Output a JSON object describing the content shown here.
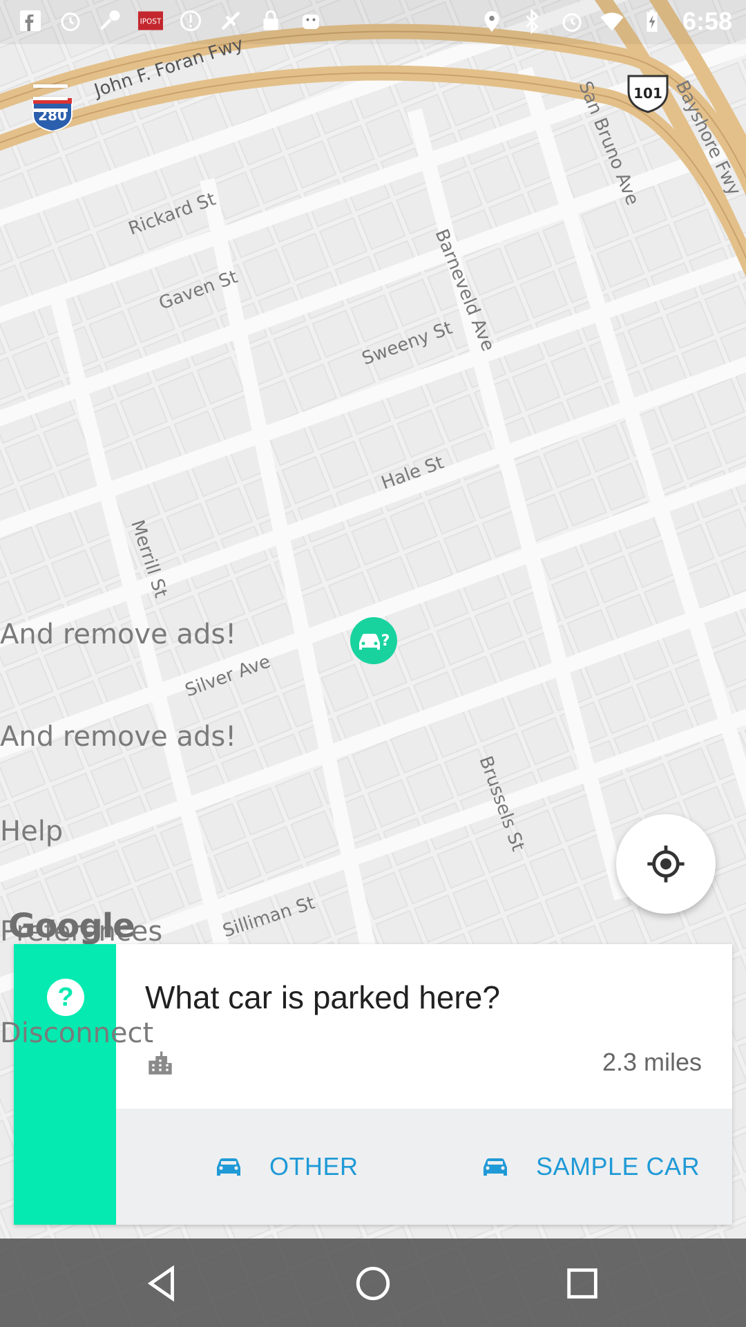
{
  "status_bar": {
    "time": "6:58",
    "left_icons": [
      "facebook-icon",
      "alarm-icon",
      "wrench-icon",
      "ipost-icon",
      "alert-icon",
      "satellite-icon",
      "lock-icon",
      "android-icon"
    ],
    "right_icons": [
      "location-icon",
      "bluetooth-icon",
      "alarm-icon",
      "wifi-icon",
      "battery-charging-icon"
    ]
  },
  "map": {
    "streets": [
      "John F. Foran Fwy",
      "San Bruno Ave",
      "Bayshore Fwy",
      "Rickard St",
      "Gaven St",
      "Sweeny St",
      "Barneveld Ave",
      "Hale St",
      "Merrill St",
      "Silver Ave",
      "Brussels St",
      "Silliman St"
    ],
    "shields": {
      "interstate": "280",
      "us": "101"
    },
    "attribution": "Google"
  },
  "menu_overlay": {
    "items": [
      "And remove ads!",
      "And remove ads!",
      "Help",
      "Preferences",
      "Disconnect"
    ]
  },
  "card": {
    "title": "What car is parked here?",
    "distance": "2.3 miles",
    "question_mark": "?",
    "actions": [
      {
        "label": "OTHER",
        "icon": "car-icon"
      },
      {
        "label": "SAMPLE CAR",
        "icon": "car-icon"
      }
    ]
  },
  "colors": {
    "accent_green": "#04eab0",
    "marker_green": "#19d39f",
    "action_blue": "#1f9ad6",
    "highway": "#e3c08a"
  }
}
